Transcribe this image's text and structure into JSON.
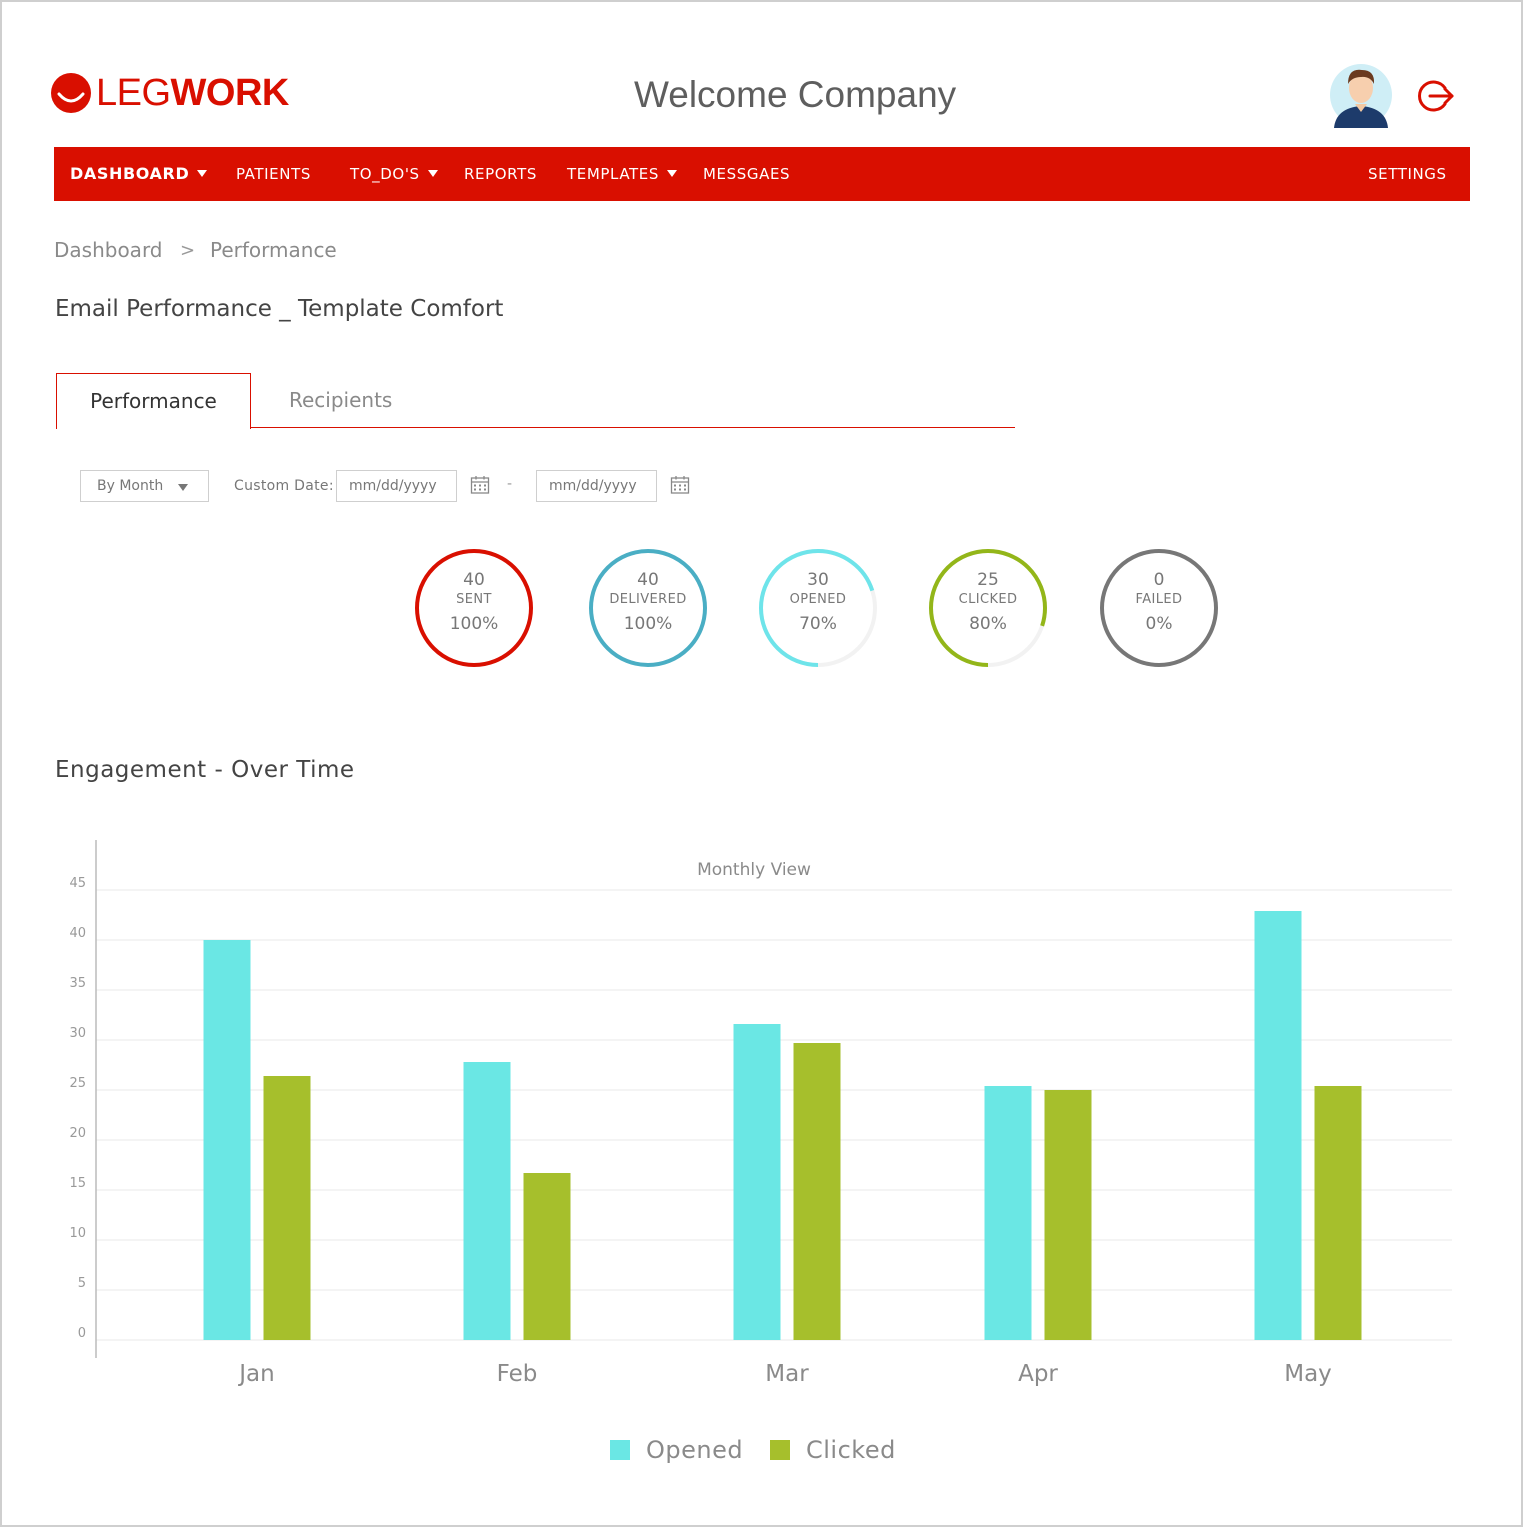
{
  "header": {
    "logo": "LEGWORK",
    "welcome": "Welcome Company"
  },
  "nav": {
    "items": [
      {
        "label": "DASHBOARD",
        "dropdown": true,
        "active": true
      },
      {
        "label": "PATIENTS",
        "dropdown": false
      },
      {
        "label": "TO_DO'S",
        "dropdown": true
      },
      {
        "label": "REPORTS",
        "dropdown": false
      },
      {
        "label": "TEMPLATES",
        "dropdown": true
      },
      {
        "label": "MESSGAES",
        "dropdown": false
      }
    ],
    "settings": "SETTINGS"
  },
  "breadcrumb": {
    "root": "Dashboard",
    "current": "Performance",
    "separator": ">"
  },
  "page_title": "Email Performance _ Template Comfort",
  "tabs": {
    "performance": "Performance",
    "recipients": "Recipients"
  },
  "filters": {
    "period": "By Month",
    "custom_date_label": "Custom Date:",
    "date_placeholder": "mm/dd/yyyy",
    "range_separator": "-"
  },
  "stats": [
    {
      "value": "40",
      "label": "SENT",
      "percent": "100%",
      "fill": 1.0,
      "color": "#d90f00"
    },
    {
      "value": "40",
      "label": "DELIVERED",
      "percent": "100%",
      "fill": 1.0,
      "color": "#4aaec4"
    },
    {
      "value": "30",
      "label": "OPENED",
      "percent": "70%",
      "fill": 0.7,
      "color": "#6ee4ea"
    },
    {
      "value": "25",
      "label": "CLICKED",
      "percent": "80%",
      "fill": 0.8,
      "color": "#93b619"
    },
    {
      "value": "0",
      "label": "FAILED",
      "percent": "0%",
      "fill": 1.0,
      "color": "#777777"
    }
  ],
  "section_title": "Engagement - Over Time",
  "colors": {
    "brand": "#d90f00",
    "opened": "#6ae7e4",
    "clicked": "#a6bf2c"
  },
  "chart_data": {
    "type": "bar",
    "title": "Monthly View",
    "categories": [
      "Jan",
      "Feb",
      "Mar",
      "Apr",
      "May"
    ],
    "series": [
      {
        "name": "Opened",
        "values": [
          40,
          27.8,
          31.6,
          25.4,
          42.9
        ]
      },
      {
        "name": "Clicked",
        "values": [
          26.4,
          16.7,
          29.7,
          25,
          25.4
        ]
      }
    ],
    "yticks": [
      "0",
      "5",
      "10",
      "15",
      "20",
      "25",
      "30",
      "35",
      "40",
      "45"
    ],
    "ylim": [
      0,
      45
    ],
    "grid": true,
    "legend": "bottom"
  }
}
